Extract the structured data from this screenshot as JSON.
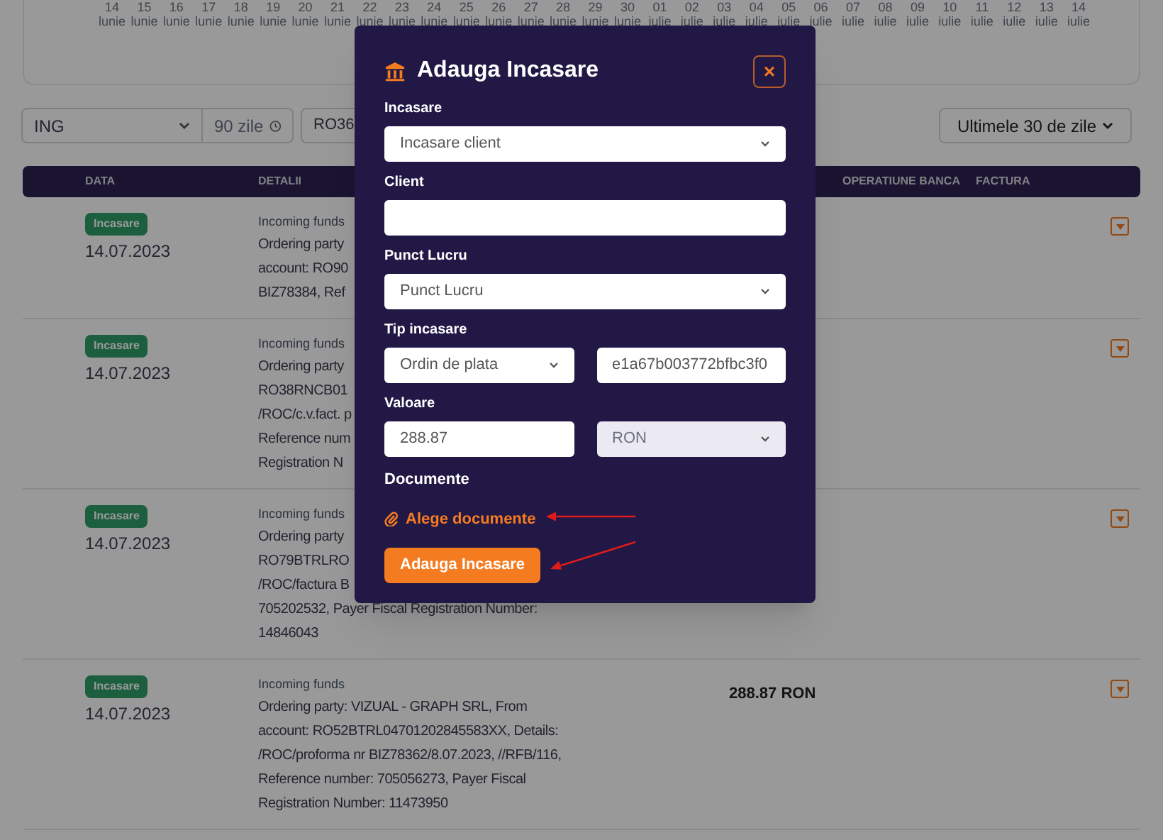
{
  "chart_axis": [
    {
      "day": "14",
      "month": "lunie"
    },
    {
      "day": "15",
      "month": "lunie"
    },
    {
      "day": "16",
      "month": "lunie"
    },
    {
      "day": "17",
      "month": "lunie"
    },
    {
      "day": "18",
      "month": "lunie"
    },
    {
      "day": "19",
      "month": "lunie"
    },
    {
      "day": "20",
      "month": "lunie"
    },
    {
      "day": "21",
      "month": "lunie"
    },
    {
      "day": "22",
      "month": "lunie"
    },
    {
      "day": "23",
      "month": "lunie"
    },
    {
      "day": "24",
      "month": "lunie"
    },
    {
      "day": "25",
      "month": "lunie"
    },
    {
      "day": "26",
      "month": "lunie"
    },
    {
      "day": "27",
      "month": "lunie"
    },
    {
      "day": "28",
      "month": "lunie"
    },
    {
      "day": "29",
      "month": "lunie"
    },
    {
      "day": "30",
      "month": "lunie"
    },
    {
      "day": "01",
      "month": "iulie"
    },
    {
      "day": "02",
      "month": "iulie"
    },
    {
      "day": "03",
      "month": "iulie"
    },
    {
      "day": "04",
      "month": "iulie"
    },
    {
      "day": "05",
      "month": "iulie"
    },
    {
      "day": "06",
      "month": "iulie"
    },
    {
      "day": "07",
      "month": "iulie"
    },
    {
      "day": "08",
      "month": "iulie"
    },
    {
      "day": "09",
      "month": "iulie"
    },
    {
      "day": "10",
      "month": "iulie"
    },
    {
      "day": "11",
      "month": "iulie"
    },
    {
      "day": "12",
      "month": "iulie"
    },
    {
      "day": "13",
      "month": "iulie"
    },
    {
      "day": "14",
      "month": "iulie"
    }
  ],
  "filters": {
    "bank": "ING",
    "period": "90 zile",
    "account": "RO36",
    "range": "Ultimele 30 de zile"
  },
  "table": {
    "columns": [
      "DATA",
      "DETALII",
      "OPERATIUNE BANCA",
      "FACTURA"
    ],
    "rows": [
      {
        "badge": "Incasare",
        "date": "14.07.2023",
        "detail_title": "Incoming funds",
        "detail_lines": [
          "Ordering party",
          "account: RO90",
          "BIZ78384, Ref"
        ]
      },
      {
        "badge": "Incasare",
        "date": "14.07.2023",
        "detail_title": "Incoming funds",
        "detail_lines": [
          "Ordering party",
          "RO38RNCB01",
          "/ROC/c.v.fact. p",
          "Reference num",
          "Registration N"
        ]
      },
      {
        "badge": "Incasare",
        "date": "14.07.2023",
        "detail_title": "Incoming funds",
        "detail_lines": [
          "Ordering party",
          "RO79BTRLRO",
          "/ROC/factura B",
          "705202532, Payer Fiscal Registration Number:",
          "14846043"
        ]
      },
      {
        "badge": "Incasare",
        "date": "14.07.2023",
        "detail_title": "Incoming funds",
        "detail_lines": [
          "Ordering party: VIZUAL - GRAPH SRL, From",
          "account: RO52BTRL04701202845583XX, Details:",
          "/ROC/proforma nr BIZ78362/8.07.2023, //RFB/116,",
          "Reference number: 705056273, Payer Fiscal",
          "Registration Number: 11473950"
        ],
        "amount": "288.87 RON"
      }
    ]
  },
  "modal": {
    "title": "Adauga Incasare",
    "close": "×",
    "groups": [
      {
        "label": "Incasare",
        "controls": [
          {
            "kind": "select",
            "value": "Incasare client",
            "disabled": false
          }
        ]
      },
      {
        "label": "Client",
        "controls": [
          {
            "kind": "input",
            "disabled": false
          }
        ]
      },
      {
        "label": "Punct Lucru",
        "controls": [
          {
            "kind": "select",
            "value": "Punct Lucru",
            "disabled": false
          }
        ]
      },
      {
        "label": "Tip incasare",
        "controls": [
          {
            "kind": "select",
            "value": "Ordin de plata",
            "disabled": false
          },
          {
            "kind": "input",
            "value": "e1a67b003772bfbc3f0",
            "disabled": false
          }
        ]
      },
      {
        "label": "Valoare",
        "controls": [
          {
            "kind": "input",
            "value": "288.87",
            "disabled": false
          },
          {
            "kind": "select",
            "value": "RON",
            "disabled": true
          }
        ]
      }
    ],
    "documents_label": "Documente",
    "documents_link": "Alege documente",
    "submit": "Adauga Incasare"
  }
}
